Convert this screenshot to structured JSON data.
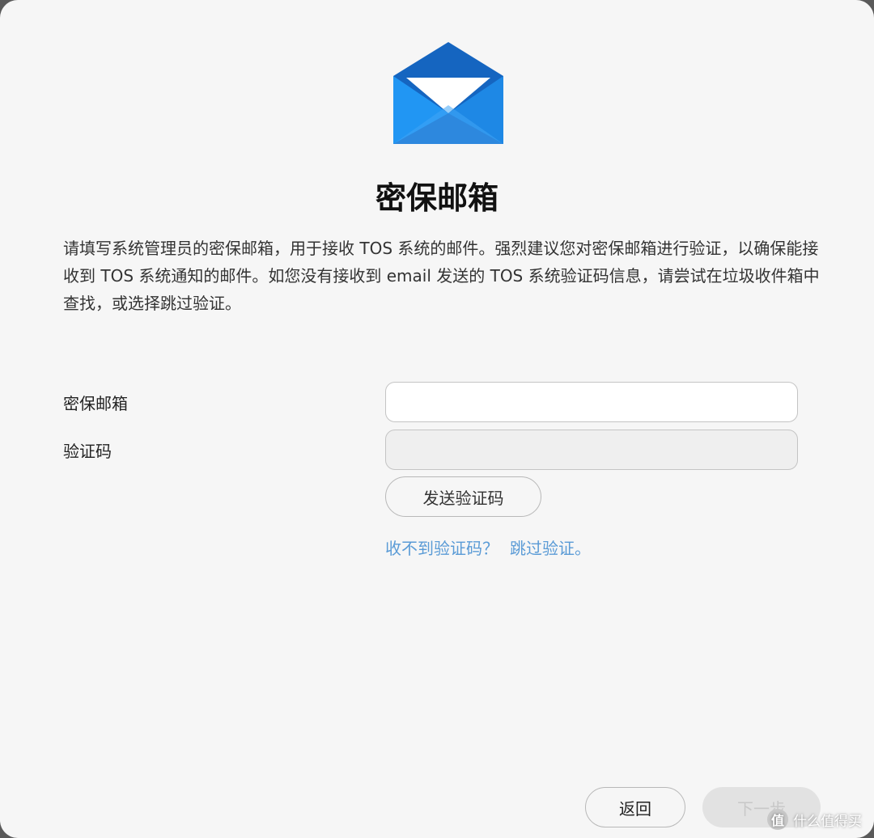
{
  "dialog": {
    "icon": "mail-envelope-icon",
    "title": "密保邮箱",
    "description": "请填写系统管理员的密保邮箱，用于接收 TOS 系统的邮件。强烈建议您对密保邮箱进行验证，以确保能接收到 TOS 系统通知的邮件。如您没有接收到 email 发送的 TOS 系统验证码信息，请尝试在垃圾收件箱中查找，或选择跳过验证。"
  },
  "form": {
    "email_label": "密保邮箱",
    "email_value": "",
    "code_label": "验证码",
    "code_value": "",
    "send_code_label": "发送验证码",
    "no_code_link": "收不到验证码？",
    "skip_link": "跳过验证。"
  },
  "footer": {
    "back_label": "返回",
    "next_label": "下一步"
  },
  "watermark": {
    "badge": "值",
    "text": "什么值得买"
  },
  "colors": {
    "background": "#f6f6f6",
    "link": "#5a9bd6",
    "icon_blue": "#1e88e5"
  }
}
